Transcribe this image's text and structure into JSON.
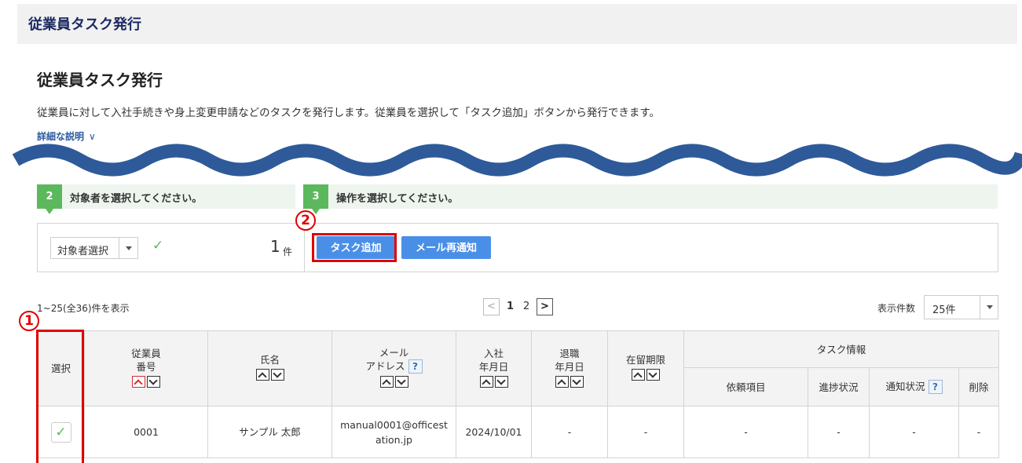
{
  "header": {
    "title": "従業員タスク発行"
  },
  "page": {
    "title": "従業員タスク発行",
    "description": "従業員に対して入社手続きや身上変更申請などのタスクを発行します。従業員を選択して「タスク追加」ボタンから発行できます。",
    "detail_link": "詳細な説明",
    "detail_chevron": "∨"
  },
  "steps": [
    {
      "num": "2",
      "label": "対象者を選択してください。"
    },
    {
      "num": "3",
      "label": "操作を選択してください。"
    }
  ],
  "selection": {
    "select_label": "対象者選択",
    "check": "✓",
    "count": "1",
    "count_unit": "件"
  },
  "actions": {
    "add_task": "タスク追加",
    "resend_mail": "メール再通知"
  },
  "annotations": {
    "marker1": "1",
    "marker2": "2",
    "color": "#e00000"
  },
  "listing": {
    "range_text": "1~25(全36)件を表示",
    "pages": [
      "1",
      "2"
    ],
    "prev": "<",
    "next": ">",
    "per_page_label": "表示件数",
    "per_page_value": "25件"
  },
  "table": {
    "headers": {
      "select": "選択",
      "emp_no_1": "従業員",
      "emp_no_2": "番号",
      "name": "氏名",
      "mail_1": "メール",
      "mail_2": "アドレス",
      "join_1": "入社",
      "join_2": "年月日",
      "leave_1": "退職",
      "leave_2": "年月日",
      "residence": "在留期限",
      "task_group": "タスク情報",
      "request": "依頼項目",
      "progress": "進捗状況",
      "notice": "通知状況",
      "delete": "削除",
      "help": "?"
    },
    "rows": [
      {
        "checked": "✓",
        "emp_no": "0001",
        "name": "サンプル 太郎",
        "mail_1": "manual0001@officest",
        "mail_2": "ation.jp",
        "join": "2024/10/01",
        "leave": "-",
        "residence": "-",
        "request": "-",
        "progress": "-",
        "notice": "-",
        "delete": "-"
      }
    ]
  },
  "colors": {
    "accent": "#4a8fe7",
    "success": "#5cb85c",
    "wave": "#2e5a9a",
    "title": "#1c2a63"
  }
}
